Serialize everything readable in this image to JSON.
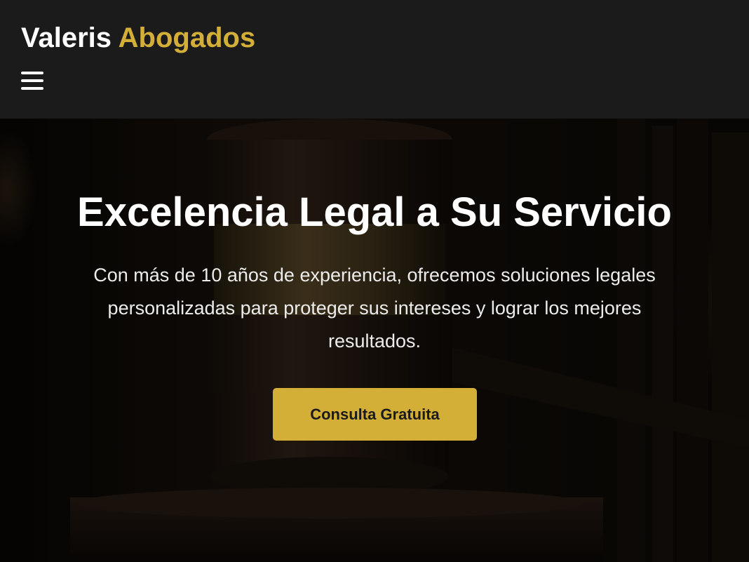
{
  "brand": {
    "name_primary": "Valeris",
    "name_accent": "Abogados",
    "accent_color": "#d4af37"
  },
  "header": {
    "menu_icon": "hamburger-menu-icon",
    "background": "#1b1b1b"
  },
  "hero": {
    "background_image": "gavel-photo",
    "title": "Excelencia Legal a Su Servicio",
    "text": "Con más de 10 años de experiencia, ofrecemos soluciones legales personalizadas para proteger sus intereses y lograr los mejores resultados.",
    "cta_label": "Consulta Gratuita"
  }
}
